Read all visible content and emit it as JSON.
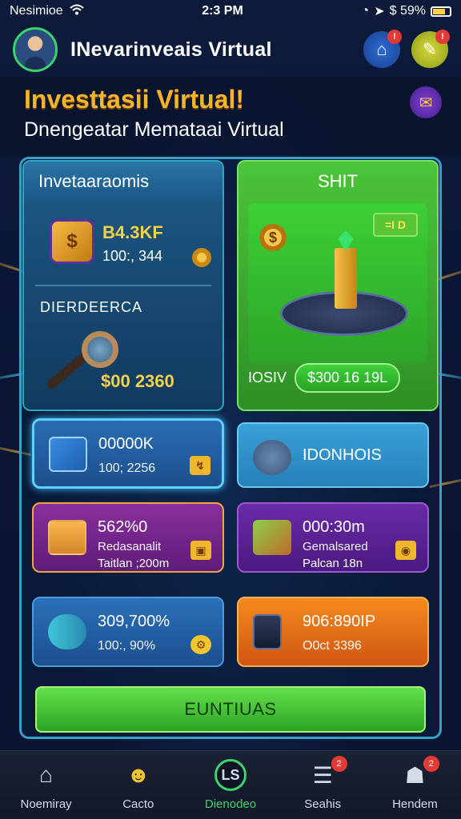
{
  "status_bar": {
    "carrier": "Nesimioe",
    "time": "2:3 PM",
    "battery": "$ 59%"
  },
  "header": {
    "title": "INevarinveais Virtual"
  },
  "banner": {
    "headline": "Investtasii Virtual!",
    "subline": "Dnengeatar Memataai Virtual"
  },
  "investments_card": {
    "title": "Invetaaraomis",
    "coin_symbol": "$",
    "amount": "B4.3KF",
    "sub_amount": "100:, 344",
    "section_label": "DIERDEERCA",
    "section_value": "$00 2360"
  },
  "start_card": {
    "title": "SHIT",
    "coin_symbol": "$",
    "tag": "=I D",
    "label": "IOSIV",
    "value": "$300 16 19L"
  },
  "tiles": [
    {
      "value": "00000K",
      "sub": "100; 2256",
      "corner": "↯"
    },
    {
      "value": "IDONHOIS"
    },
    {
      "value": "562%0",
      "sub": "Redasanalit",
      "sub2": "Taitlan ;200m",
      "corner": "▣"
    },
    {
      "value": "000:30m",
      "sub": "Gemalsared",
      "sub2": "Palcan 18n",
      "corner": "◉"
    },
    {
      "value": "309,700%",
      "sub": "100:, 90%",
      "corner": "⚙"
    },
    {
      "value": "906:890IP",
      "sub": "O0ct 3396"
    }
  ],
  "continue_button": {
    "label": "EUNTIUAS"
  },
  "nav": [
    {
      "label": "Noemiray",
      "icon": "home-icon",
      "glyph": "⌂"
    },
    {
      "label": "Cacto",
      "icon": "smiley-icon",
      "glyph": "☻"
    },
    {
      "label": "Dienodeo",
      "icon": "ls-icon",
      "glyph": "LS",
      "active": true
    },
    {
      "label": "Seahis",
      "icon": "list-icon",
      "glyph": "☰",
      "badge": "2"
    },
    {
      "label": "Hendem",
      "icon": "profile-icon",
      "glyph": "☗",
      "badge": "2"
    }
  ],
  "colors": {
    "accent_green": "#3dd36b",
    "headline_gold": "#f4b52c",
    "frame_blue": "#3aa0c7"
  }
}
